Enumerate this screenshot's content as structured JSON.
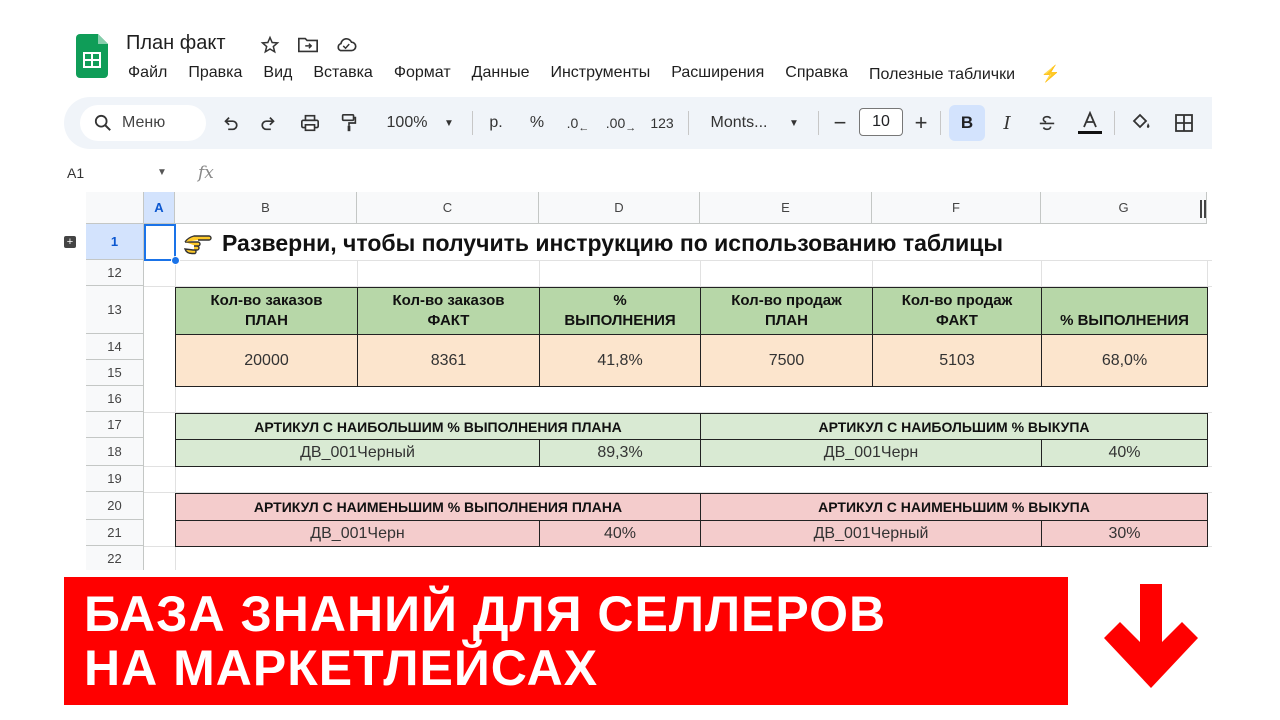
{
  "app": {
    "doc_title": "План факт",
    "menu": [
      "Файл",
      "Правка",
      "Вид",
      "Вставка",
      "Формат",
      "Данные",
      "Инструменты",
      "Расширения",
      "Справка",
      "Полезные таблички"
    ],
    "menu_extra_icon": "lightning-icon",
    "brand_color": "#0f9d58"
  },
  "toolbar": {
    "search_label": "Меню",
    "zoom": "100%",
    "currency": "р.",
    "percent": "%",
    "dec_decrease": ".0",
    "dec_increase": ".00",
    "number_format": "123",
    "font_name": "Monts...",
    "font_size": "10",
    "bold": "B",
    "italic": "I"
  },
  "formula_bar": {
    "cell_ref": "A1",
    "fx": "fx"
  },
  "columns": [
    "A",
    "B",
    "C",
    "D",
    "E",
    "F",
    "G"
  ],
  "rows": [
    "1",
    "12",
    "13",
    "14",
    "15",
    "16",
    "17",
    "18",
    "19",
    "20",
    "21",
    "22"
  ],
  "banner": {
    "icon": "pointing-hand-icon",
    "text": "Разверни, чтобы получить инструкцию по использованию таблицы"
  },
  "summary": {
    "headers": [
      [
        "Кол-во заказов",
        "ПЛАН"
      ],
      [
        "Кол-во заказов",
        "ФАКТ"
      ],
      [
        "%",
        "ВЫПОЛНЕНИЯ"
      ],
      [
        "Кол-во продаж",
        "ПЛАН"
      ],
      [
        "Кол-во продаж",
        "ФАКТ"
      ],
      [
        "",
        "% ВЫПОЛНЕНИЯ"
      ]
    ],
    "values": [
      "20000",
      "8361",
      "41,8%",
      "7500",
      "5103",
      "68,0%"
    ]
  },
  "best": {
    "plan_header": "АРТИКУЛ С НАИБОЛЬШИМ % ВЫПОЛНЕНИЯ ПЛАНА",
    "plan_article": "ДВ_001Черный",
    "plan_value": "89,3%",
    "buyout_header": "АРТИКУЛ С НАИБОЛЬШИМ % ВЫКУПА",
    "buyout_article": "ДВ_001Черн",
    "buyout_value": "40%"
  },
  "worst": {
    "plan_header": "АРТИКУЛ С НАИМЕНЬШИМ % ВЫПОЛНЕНИЯ ПЛАНА",
    "plan_article": "ДВ_001Черн",
    "plan_value": "40%",
    "buyout_header": "АРТИКУЛ С НАИМЕНЬШИМ % ВЫКУПА",
    "buyout_article": "ДВ_001Черный",
    "buyout_value": "30%"
  },
  "promo": {
    "line1": "БАЗА ЗНАНИЙ ДЛЯ СЕЛЛЕРОВ",
    "line2": "НА МАРКЕТЛЕЙСАХ",
    "color": "#ff0000",
    "arrow_icon": "down-arrow-icon"
  }
}
